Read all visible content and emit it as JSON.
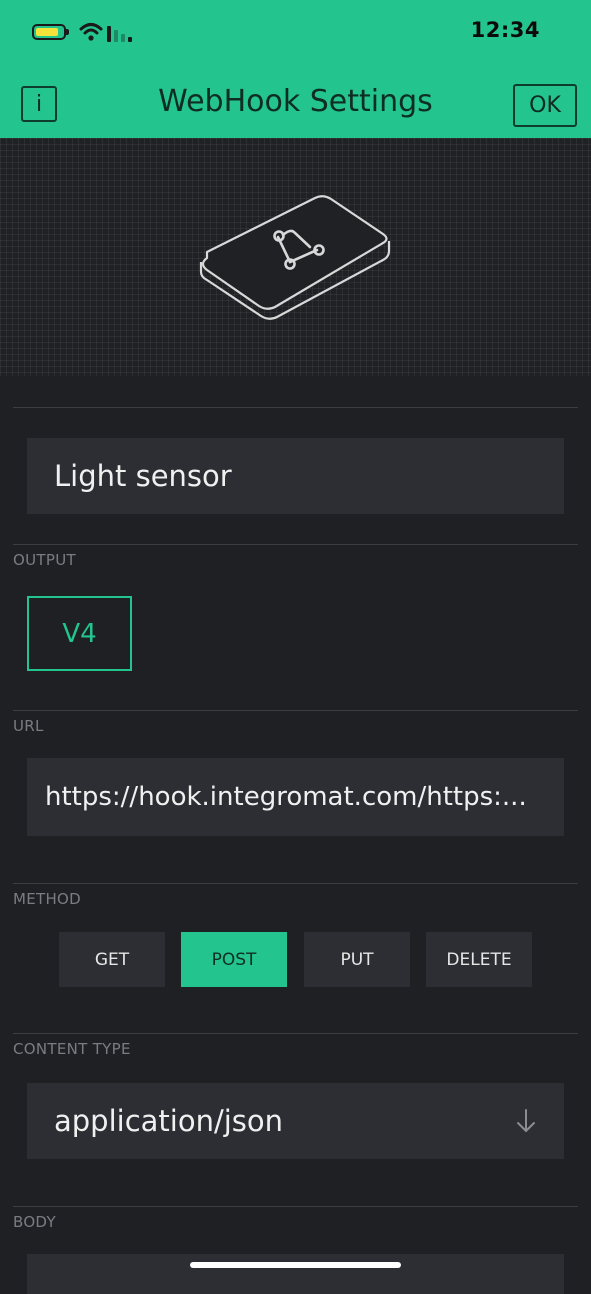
{
  "status_bar": {
    "time": "12:34"
  },
  "header": {
    "info_label": "i",
    "title": "WebHook Settings",
    "ok_label": "OK"
  },
  "form": {
    "name_value": "Light sensor",
    "output": {
      "label": "OUTPUT",
      "pin": "V4"
    },
    "url": {
      "label": "URL",
      "value": "https://hook.integromat.com/https:..."
    },
    "method": {
      "label": "METHOD",
      "options": [
        "GET",
        "POST",
        "PUT",
        "DELETE"
      ],
      "selected": "POST"
    },
    "content_type": {
      "label": "CONTENT TYPE",
      "value": "application/json"
    },
    "body": {
      "label": "BODY"
    }
  },
  "colors": {
    "accent": "#23c48e",
    "background": "#1e2024",
    "field": "#2c2e33",
    "battery": "#f4e23a"
  },
  "icons": [
    "battery-icon",
    "wifi-icon",
    "cellular-signal-icon",
    "webhook-device-icon",
    "arrow-down-icon"
  ]
}
